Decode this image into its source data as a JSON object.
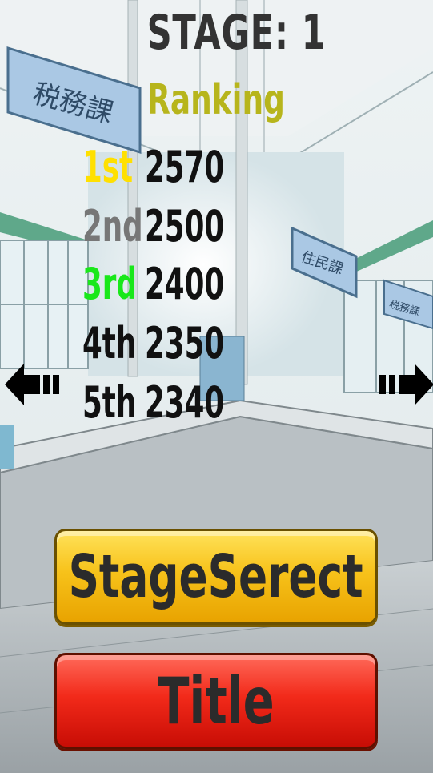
{
  "stage": {
    "label": "STAGE: 1"
  },
  "ranking": {
    "heading": "Ranking",
    "entries": [
      {
        "place": "1st",
        "score": "2570",
        "color": "#ffe000"
      },
      {
        "place": "2nd",
        "score": "2500",
        "color": "#777777"
      },
      {
        "place": "3rd",
        "score": "2400",
        "color": "#19e81a"
      },
      {
        "place": "4th",
        "score": "2350",
        "color": "#111111"
      },
      {
        "place": "5th",
        "score": "2340",
        "color": "#111111"
      }
    ]
  },
  "background": {
    "signs": [
      "税務課",
      "住民課",
      "税務課"
    ]
  },
  "buttons": {
    "stage_select": "StageSerect",
    "title": "Title"
  },
  "icons": {
    "left": "arrow-left-icon",
    "right": "arrow-right-icon"
  },
  "colors": {
    "ranking": "#b7b51c",
    "stage_button": "#f7c21a",
    "title_button": "#f22a1a"
  }
}
